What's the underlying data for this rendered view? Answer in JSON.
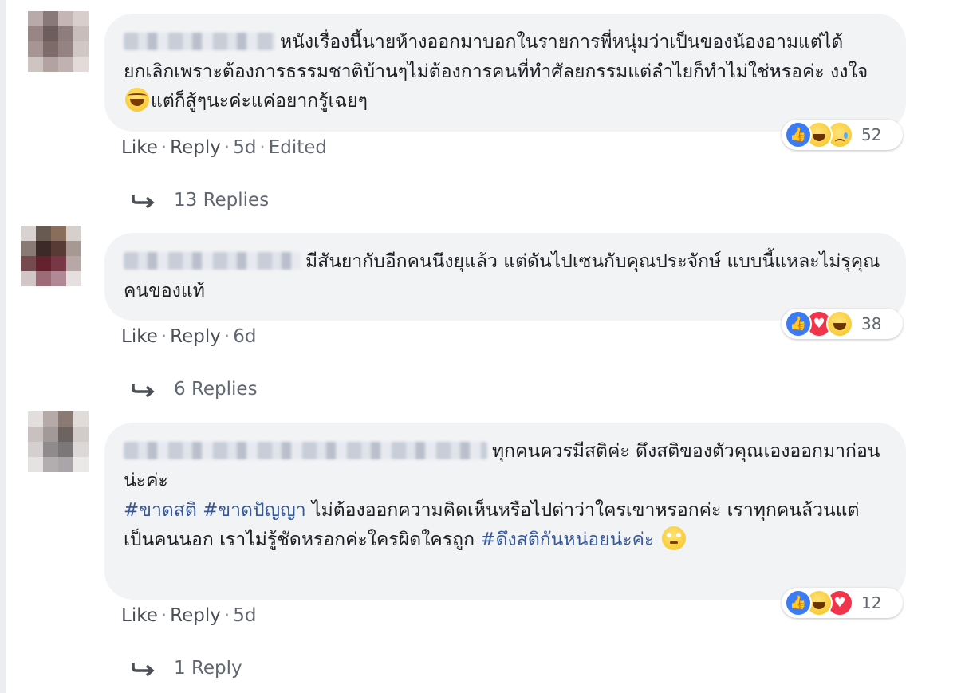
{
  "comments": [
    {
      "text_parts": [
        "หนังเรื่องนี้นายห้างออกมาบอกในรายการพี่หนุ่มว่าเป็นของน้องอามแต่ได้ยกเลิกเพราะต้องการธรรมชาติบ้านๆไม่ต้องการคนที่ทำศัลยกรรมแต่ลำไยก็ทำไม่ใช่หรอค่ะ งงใจ",
        "แต่ก็สู้ๆนะค่ะแค่อยากรู้เฉยๆ"
      ],
      "emoji_inline": "laughing-tears-icon",
      "actions": {
        "like": "Like",
        "reply": "Reply",
        "time": "5d",
        "edited": "Edited"
      },
      "reactions": {
        "icons": [
          "like",
          "haha",
          "sad"
        ],
        "count": "52"
      },
      "replies_label": "13 Replies"
    },
    {
      "text": "มีสันยากับอีกคนนึงยุแล้ว แต่ดันไปเซนกับคุณประจักษ์ แบบนี้แหละไม่รุคุณคนของแท้",
      "actions": {
        "like": "Like",
        "reply": "Reply",
        "time": "6d"
      },
      "reactions": {
        "icons": [
          "like",
          "love",
          "haha"
        ],
        "count": "38"
      },
      "replies_label": "6 Replies"
    },
    {
      "line1": "ทุกคนควรมีสติค่ะ ดึงสติของตัวคุณเองออกมาก่อนน่ะค่ะ",
      "hashtag1": "#ขาดสติ",
      "hashtag2": "#ขาดปัญญา",
      "body": " ไม่ต้องออกความคิดเห็นหรือไปด่าว่าใครเขาหรอกค่ะ เราทุกคนล้วนแต่เป็นคนนอก เราไม่รู้ชัดหรอกค่ะใครผิดใครถูก ",
      "hashtag3": "#ดึงสติกันหน่อยน่ะค่ะ",
      "emoji_inline": "eye-roll-icon",
      "actions": {
        "like": "Like",
        "reply": "Reply",
        "time": "5d"
      },
      "reactions": {
        "icons": [
          "like",
          "haha",
          "love"
        ],
        "count": "12"
      },
      "replies_label": "1 Reply"
    }
  ],
  "separator": "·",
  "colors": {
    "bubble": "#f2f3f5",
    "link": "#365899",
    "meta": "#606770",
    "like_blue": "#3b7cf5",
    "love_red": "#f0344c",
    "haha_yellow": "#f6c21c"
  }
}
